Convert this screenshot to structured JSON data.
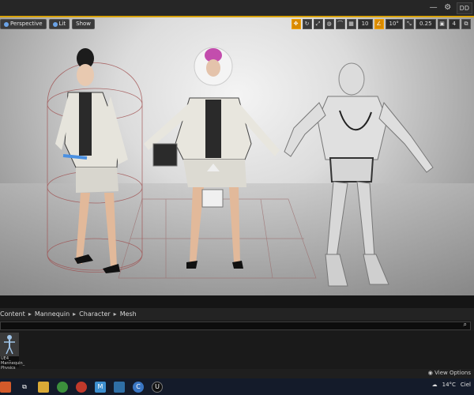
{
  "top_bar": {
    "label": "DD"
  },
  "viewport": {
    "view_mode": "Perspective",
    "lighting": "Lit",
    "show": "Show",
    "grid_snap": "10",
    "rotation_snap": "10°",
    "scale_snap": "0.25",
    "camera_speed": "4"
  },
  "content_path": [
    "Content",
    "Mannequin",
    "Character",
    "Mesh"
  ],
  "asset": {
    "label_line1": "UE4_",
    "label_line2": "Mannequin_",
    "label_line3": "Physics"
  },
  "view_options": "View Options",
  "taskbar": {
    "temperature": "14°C",
    "weather": "Ciel"
  }
}
